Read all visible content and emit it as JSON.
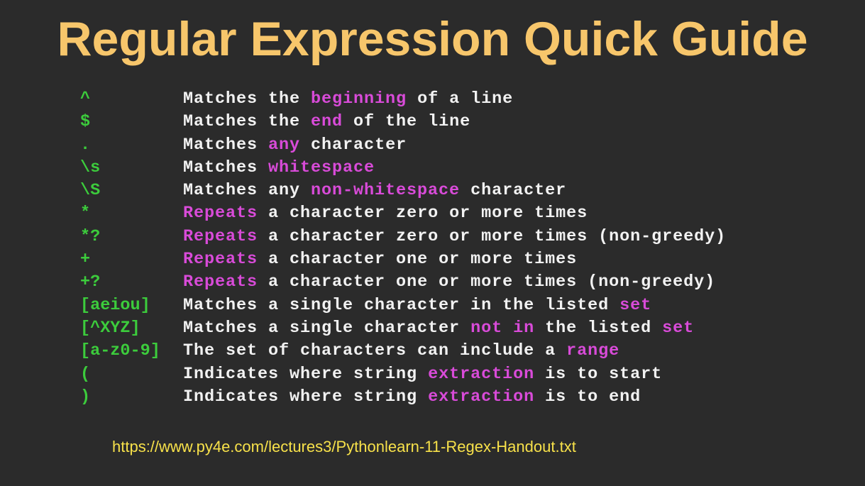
{
  "title": "Regular Expression Quick Guide",
  "url": "https://www.py4e.com/lectures3/Pythonlearn-11-Regex-Handout.txt",
  "colors": {
    "background": "#2b2b2b",
    "title": "#f7c66b",
    "code": "#3ccc3c",
    "text": "#f2f2f2",
    "highlight": "#d94bd9",
    "url": "#f7e14a"
  },
  "rows": [
    {
      "code": "^",
      "parts": [
        {
          "t": "Matches the "
        },
        {
          "t": "beginning",
          "hl": true
        },
        {
          "t": " of a line"
        }
      ]
    },
    {
      "code": "$",
      "parts": [
        {
          "t": "Matches the "
        },
        {
          "t": "end",
          "hl": true
        },
        {
          "t": " of the line"
        }
      ]
    },
    {
      "code": ".",
      "parts": [
        {
          "t": "Matches "
        },
        {
          "t": "any",
          "hl": true
        },
        {
          "t": " character"
        }
      ]
    },
    {
      "code": "\\s",
      "parts": [
        {
          "t": "Matches "
        },
        {
          "t": "whitespace",
          "hl": true
        }
      ]
    },
    {
      "code": "\\S",
      "parts": [
        {
          "t": "Matches any "
        },
        {
          "t": "non-whitespace",
          "hl": true
        },
        {
          "t": " character"
        }
      ]
    },
    {
      "code": "*",
      "parts": [
        {
          "t": "Repeats",
          "hl": true
        },
        {
          "t": " a character zero or more times"
        }
      ]
    },
    {
      "code": "*?",
      "parts": [
        {
          "t": "Repeats",
          "hl": true
        },
        {
          "t": " a character zero or more times (non-greedy)"
        }
      ]
    },
    {
      "code": "+",
      "parts": [
        {
          "t": "Repeats",
          "hl": true
        },
        {
          "t": " a character one or more times"
        }
      ]
    },
    {
      "code": "+?",
      "parts": [
        {
          "t": "Repeats",
          "hl": true
        },
        {
          "t": " a character one or more times (non-greedy)"
        }
      ]
    },
    {
      "code": "[aeiou]",
      "parts": [
        {
          "t": "Matches a single character in the listed "
        },
        {
          "t": "set",
          "hl": true
        }
      ]
    },
    {
      "code": "[^XYZ]",
      "parts": [
        {
          "t": "Matches a single character "
        },
        {
          "t": "not in",
          "hl": true
        },
        {
          "t": " the listed "
        },
        {
          "t": "set",
          "hl": true
        }
      ]
    },
    {
      "code": "[a-z0-9]",
      "parts": [
        {
          "t": "The set of characters can include a "
        },
        {
          "t": "range",
          "hl": true
        }
      ]
    },
    {
      "code": "(",
      "parts": [
        {
          "t": "Indicates where string "
        },
        {
          "t": "extraction",
          "hl": true
        },
        {
          "t": " is to start"
        }
      ]
    },
    {
      "code": ")",
      "parts": [
        {
          "t": "Indicates where string "
        },
        {
          "t": "extraction",
          "hl": true
        },
        {
          "t": " is to end"
        }
      ]
    }
  ]
}
